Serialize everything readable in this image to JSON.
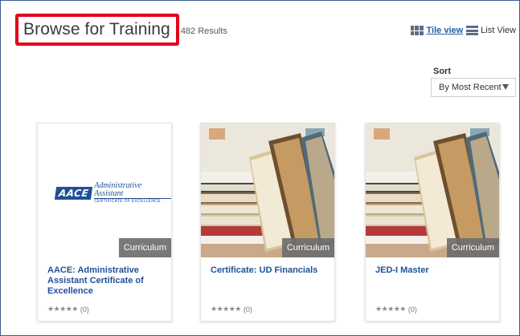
{
  "header": {
    "title": "Browse for Training",
    "results": "482 Results"
  },
  "views": {
    "tile_label": "Tile view",
    "list_label": "List View"
  },
  "sort": {
    "label": "Sort",
    "selected": "By Most Recent"
  },
  "cards": [
    {
      "name": "AACE: Administrative Assistant Certificate of Excellence",
      "type": "Curriculum",
      "rating_count": "(0)",
      "logo": {
        "mark": "AACE",
        "line1": "Administrative Assistant",
        "line2": "CERTIFICATE OF EXCELLENCE"
      }
    },
    {
      "name": "Certificate: UD Financials",
      "type": "Curriculum",
      "rating_count": "(0)"
    },
    {
      "name": "JED-I Master",
      "type": "Curriculum",
      "rating_count": "(0)"
    }
  ],
  "colors": {
    "accent_red": "#e3001b",
    "link_blue": "#1f5fa8",
    "title_blue": "#1f4f9a",
    "frame_border": "#3a5d8f"
  },
  "icons": [
    "grid-view-icon",
    "list-view-icon",
    "sort-caret-icon",
    "star-rating-icon"
  ]
}
